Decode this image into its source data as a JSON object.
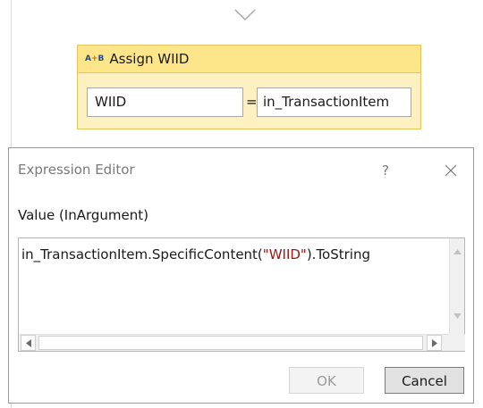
{
  "assign_activity": {
    "icon": {
      "name": "assign-icon",
      "prefix": "A",
      "plus": "+",
      "suffix": "B"
    },
    "title": "Assign WIID",
    "to_field": "WIID",
    "operator": "=",
    "value_field": "in_TransactionItem"
  },
  "expression_editor": {
    "title": "Expression Editor",
    "help_label": "?",
    "section_label": "Value (InArgument)",
    "expression": {
      "prefix": "in_TransactionItem.SpecificContent(",
      "string_literal": "\"WIID\"",
      "suffix": ").ToString"
    },
    "ok_label": "OK",
    "cancel_label": "Cancel",
    "ok_enabled": false
  },
  "colors": {
    "assign_header": "#fde58a",
    "assign_body": "#fdf1c1",
    "assign_border": "#e7c45f",
    "string_literal": "#a31515"
  }
}
